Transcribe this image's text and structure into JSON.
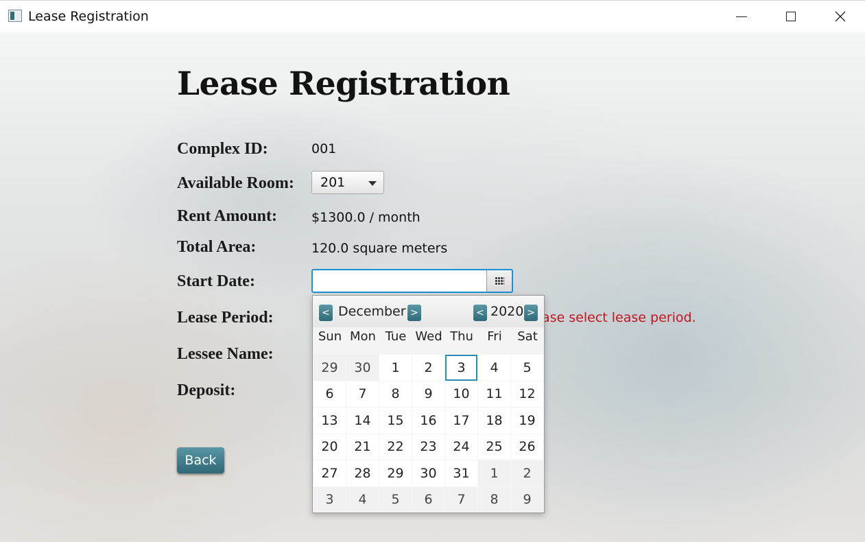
{
  "window": {
    "title": "Lease Registration",
    "icons": [
      "app-icon",
      "minimize-icon",
      "maximize-icon",
      "close-icon"
    ]
  },
  "form": {
    "heading": "Lease Registration",
    "complex_id_label": "Complex ID:",
    "complex_id_value": "001",
    "room_label": "Available Room:",
    "room_selected": "201",
    "rent_label": "Rent Amount:",
    "rent_value": "$1300.0 / month",
    "area_label": "Total Area:",
    "area_value": "120.0 square meters",
    "start_date_label": "Start Date:",
    "start_date_value": "",
    "lease_period_label": "Lease Period:",
    "lease_period_error": "ase select lease period.",
    "lessee_label": "Lessee Name:",
    "deposit_label": "Deposit:",
    "back_label": "Back",
    "colors": {
      "error": "#c0161c",
      "accent": "#2f6877",
      "focus": "#1c8fd6"
    }
  },
  "datepicker": {
    "month": "December",
    "year": "2020",
    "prev_glyph": "<",
    "next_glyph": ">",
    "weekdays": [
      "Sun",
      "Mon",
      "Tue",
      "Wed",
      "Thu",
      "Fri",
      "Sat"
    ],
    "today": "3",
    "weeks": [
      [
        "29",
        "30",
        "1",
        "2",
        "3",
        "4",
        "5"
      ],
      [
        "6",
        "7",
        "8",
        "9",
        "10",
        "11",
        "12"
      ],
      [
        "13",
        "14",
        "15",
        "16",
        "17",
        "18",
        "19"
      ],
      [
        "20",
        "21",
        "22",
        "23",
        "24",
        "25",
        "26"
      ],
      [
        "27",
        "28",
        "29",
        "30",
        "31",
        "1",
        "2"
      ],
      [
        "3",
        "4",
        "5",
        "6",
        "7",
        "8",
        "9"
      ]
    ]
  }
}
